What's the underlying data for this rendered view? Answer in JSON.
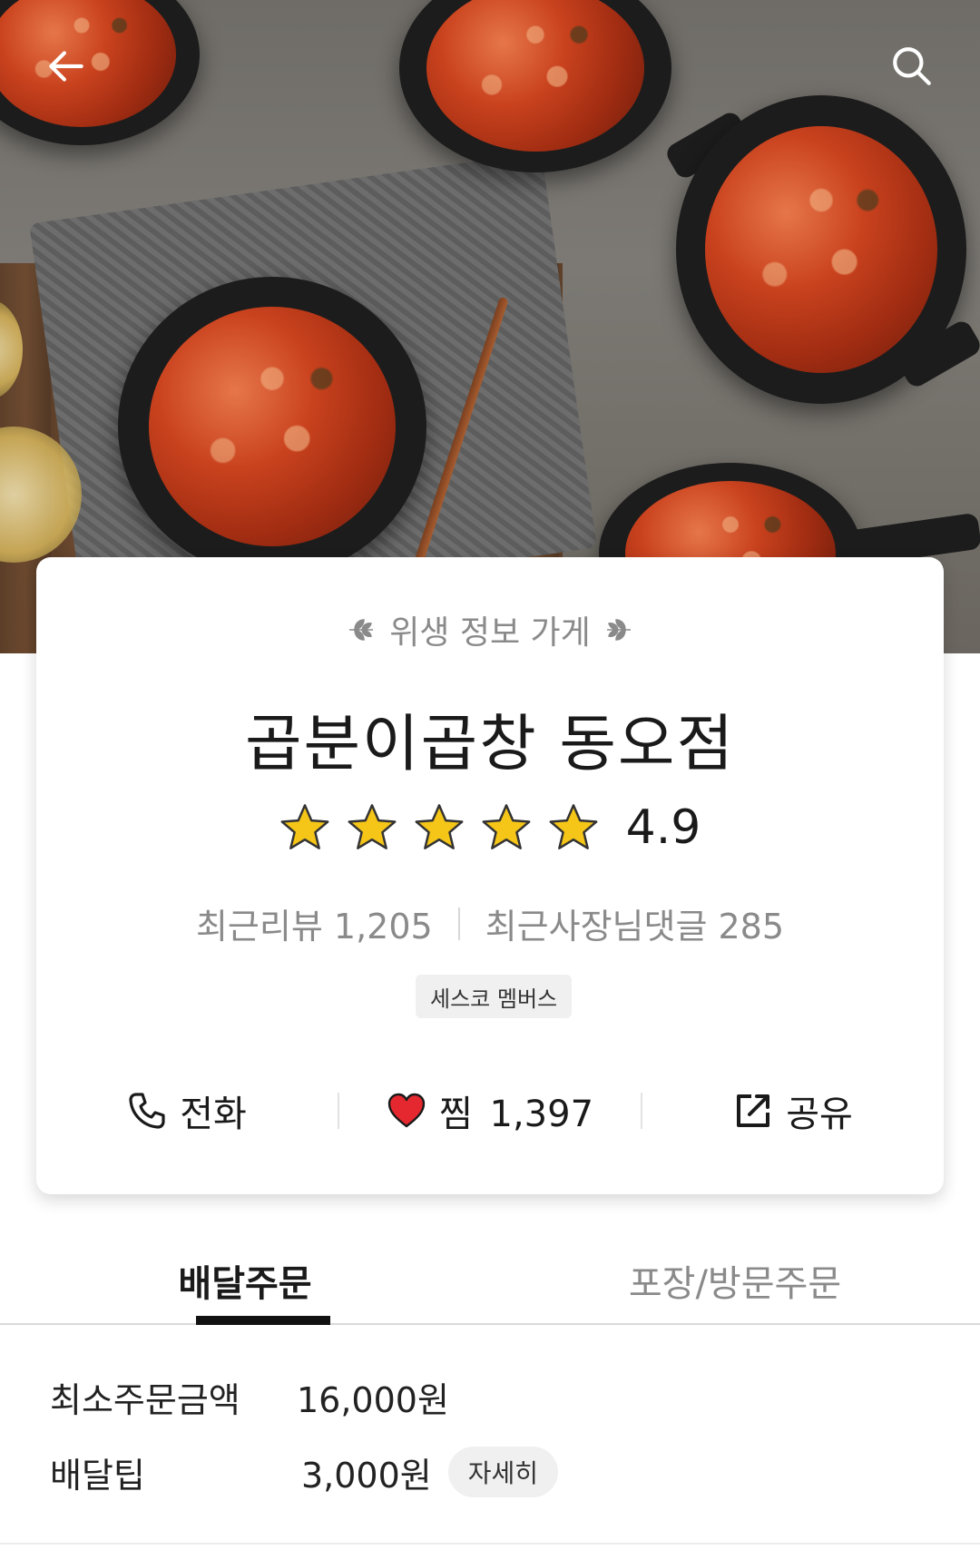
{
  "header": {
    "back_icon": "arrow-left-icon",
    "search_icon": "search-icon"
  },
  "store": {
    "hygiene_label": "위생 정보 가게",
    "name": "곱분이곱창 동오점",
    "rating": {
      "stars": 5,
      "max_stars": 5,
      "score": "4.9"
    },
    "reviews_label": "최근리뷰 1,205",
    "owner_replies_label": "최근사장님댓글 285",
    "badge": "세스코 멤버스"
  },
  "actions": {
    "call_label": "전화",
    "favorite_label": "찜",
    "favorite_count": "1,397",
    "share_label": "공유"
  },
  "tabs": {
    "delivery": "배달주문",
    "pickup": "포장/방문주문"
  },
  "delivery_info": {
    "min_order_label": "최소주문금액",
    "min_order_value": "16,000원",
    "tip_label": "배달팁",
    "tip_value": "3,000원",
    "detail_button": "자세히"
  },
  "colors": {
    "star": "#f5c518",
    "heart": "#e5282f",
    "muted_text": "#8a8a8a",
    "active_tab_underline": "#111111"
  }
}
